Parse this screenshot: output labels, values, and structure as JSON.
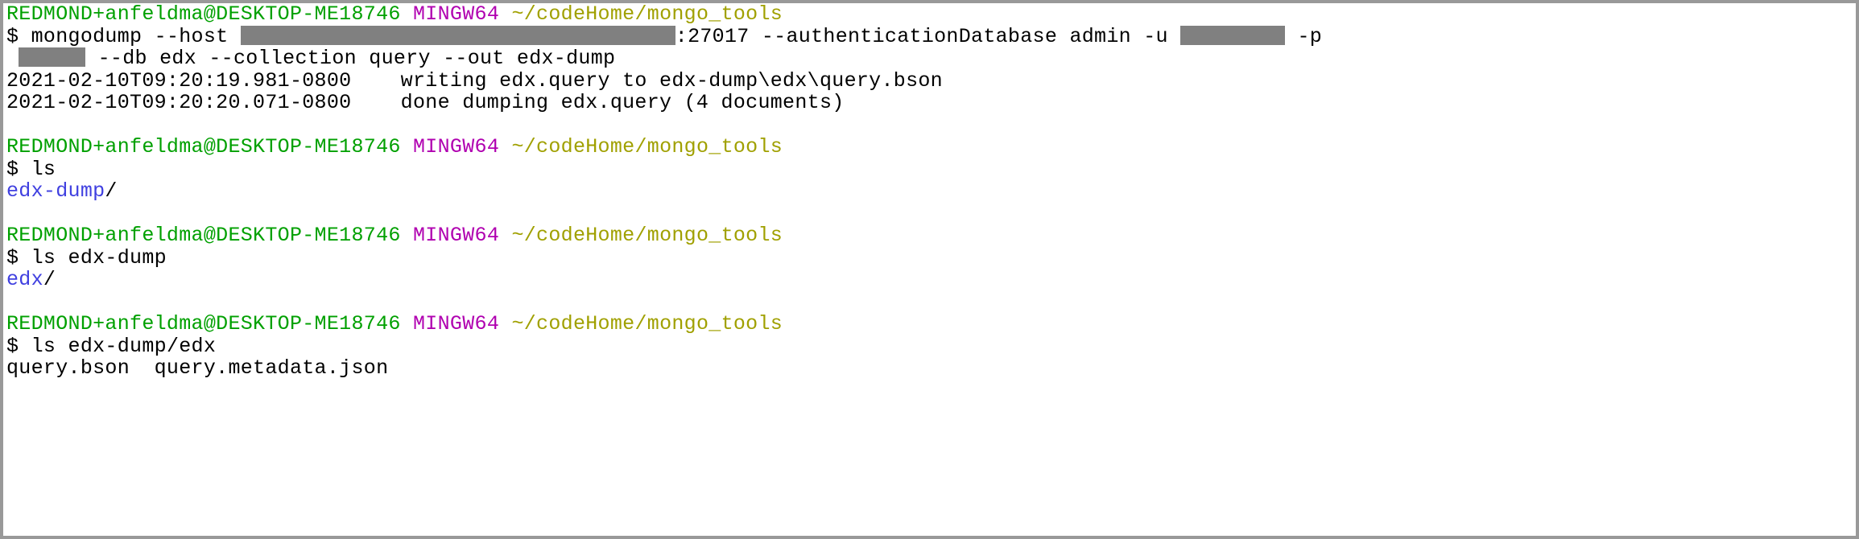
{
  "prompt": {
    "user_host": "REDMOND+anfeldma@DESKTOP-ME18746",
    "mingw": "MINGW64",
    "path": "~/codeHome/mongo_tools",
    "symbol": "$"
  },
  "block1": {
    "cmd_part1": " mongodump --host ",
    "cmd_part2": ":27017 --authenticationDatabase admin -u ",
    "cmd_part3": " -p",
    "cmd_line2_part1": " --db edx --collection query --out edx-dump",
    "out1": "2021-02-10T09:20:19.981-0800    writing edx.query to edx-dump\\edx\\query.bson",
    "out2": "2021-02-10T09:20:20.071-0800    done dumping edx.query (4 documents)"
  },
  "block2": {
    "cmd": " ls",
    "out_dir": "edx-dump",
    "out_slash": "/"
  },
  "block3": {
    "cmd": " ls edx-dump",
    "out_dir": "edx",
    "out_slash": "/"
  },
  "block4": {
    "cmd": " ls edx-dump/edx",
    "out": "query.bson  query.metadata.json"
  }
}
